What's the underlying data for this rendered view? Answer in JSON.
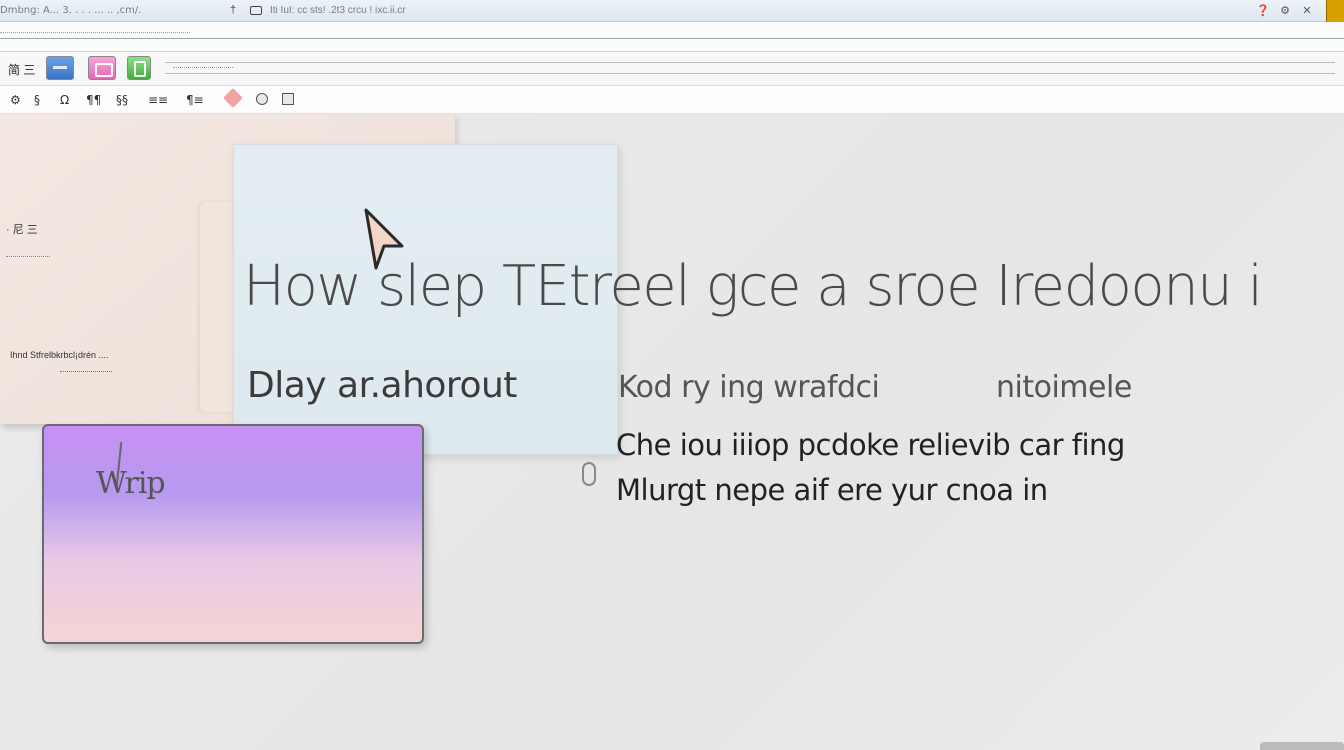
{
  "titlebar": {
    "left_text": "Dmbng: A... 3.  .  . .   ...  .. ,cm/.",
    "separator": "†",
    "doc_text": "Iti IuI: cc sts! .2t3 crcu ! ixc.ii.cr"
  },
  "window_controls": [
    "❓",
    "⚙",
    "✕"
  ],
  "toolbar": {
    "label": "简 三"
  },
  "toolbar2": {
    "icons": [
      "⚙",
      "§",
      "Ω",
      "¶¶",
      "§§",
      "≡≡",
      "¶≡"
    ]
  },
  "beige_panel": {
    "line1": "· 尼 三",
    "line2": "Ihnd Stfrelbkrbcl¡drén ...."
  },
  "headline": "How slep TEtreel  gce a sroe  Iredoonu i",
  "subline": {
    "left": "Dlay  ar.ahorout",
    "right_a": "Kod ry ing  wrafdci",
    "right_b": "nitoimele"
  },
  "paragraph": {
    "line1": "Che iou iiiop pcdoke relievib car fing",
    "line2": "Mlurgt nepe aif ere yur cnoa  in"
  },
  "purple_card": {
    "label": "Wrip"
  },
  "colors": {
    "accent_blue": "#3b73c4",
    "accent_pink": "#e268b5",
    "accent_green": "#3fae3a",
    "card_blue": "#e4eef2",
    "card_purple_top": "#c690f2",
    "card_purple_bottom": "#f6d4d2",
    "panel_beige": "#f4e9e2"
  }
}
